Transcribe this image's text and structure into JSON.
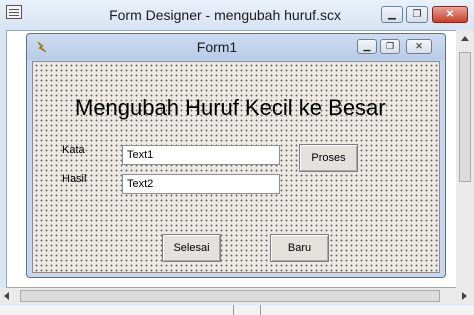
{
  "designer": {
    "title": "Form Designer - mengubah huruf.scx",
    "controls": {
      "minimize": "▁",
      "restore": "❐",
      "close": "✕"
    }
  },
  "form": {
    "title": "Form1",
    "controls": {
      "minimize": "▁",
      "restore": "❐",
      "close": "✕"
    },
    "heading": "Mengubah Huruf Kecil ke Besar",
    "kata_label": "Kata",
    "hasil_label": "Hasil",
    "text1_value": "Text1",
    "text2_value": "Text2",
    "proses_label": "Proses",
    "selesai_label": "Selesai",
    "baru_label": "Baru"
  },
  "colors": {
    "title_bar": "#d7e3f2",
    "form_surface": "#ece9e4",
    "grid_dot": "#6a6a6a"
  }
}
